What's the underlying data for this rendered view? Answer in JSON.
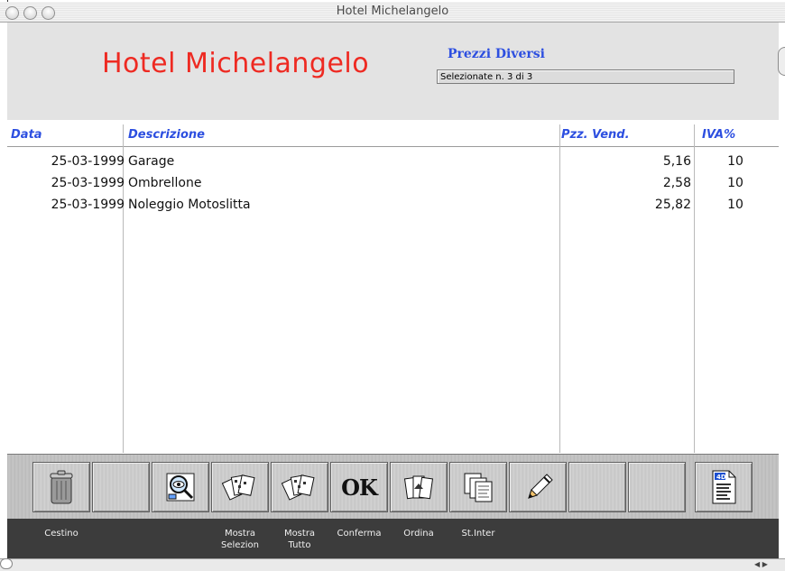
{
  "window": {
    "title": "Hotel Michelangelo"
  },
  "header": {
    "hotel_name": "Hotel Michelangelo",
    "subtitle": "Prezzi Diversi",
    "selection_status": "Selezionate n. 3 di 3"
  },
  "table": {
    "columns": {
      "data": "Data",
      "descrizione": "Descrizione",
      "prezzo": "Pzz. Vend.",
      "iva": "IVA%"
    },
    "rows": [
      {
        "data": "25-03-1999",
        "descrizione": "Garage",
        "prezzo": "5,16",
        "iva": "10"
      },
      {
        "data": "25-03-1999",
        "descrizione": "Ombrellone",
        "prezzo": "2,58",
        "iva": "10"
      },
      {
        "data": "25-03-1999",
        "descrizione": "Noleggio Motoslitta",
        "prezzo": "25,82",
        "iva": "10"
      }
    ]
  },
  "toolbar": {
    "cestino": "Cestino",
    "mostra_selezion_1": "Mostra",
    "mostra_selezion_2": "Selezion",
    "mostra_tutto_1": "Mostra",
    "mostra_tutto_2": "Tutto",
    "conferma": "Conferma",
    "ordina": "Ordina",
    "st_inter": "St.Inter",
    "ok_glyph": "OK",
    "icons": [
      "trash-icon",
      "blank",
      "search-eye-icon",
      "cards-stack-icon",
      "cards-stack-icon",
      "ok-icon",
      "sort-icon",
      "print-pages-icon",
      "pencil-icon",
      "blank",
      "blank",
      "document-4d-icon"
    ]
  }
}
